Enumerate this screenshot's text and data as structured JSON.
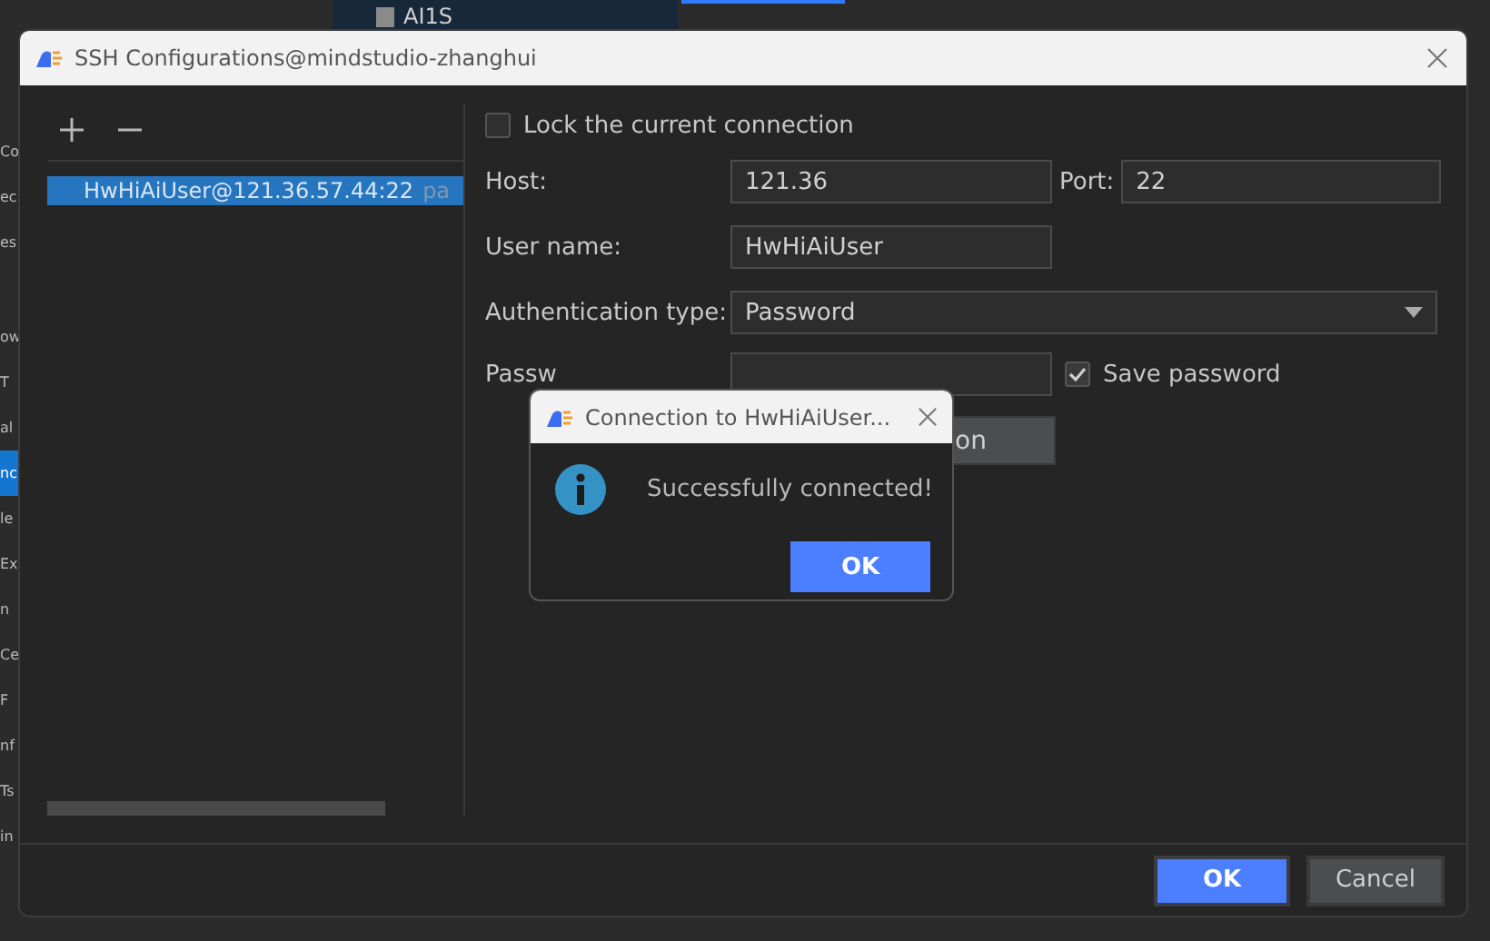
{
  "background": {
    "tab_label": "AI1S",
    "sidebar_groups": [
      [
        {
          "text": "Co",
          "selected": false
        },
        {
          "text": "ec",
          "selected": false
        },
        {
          "text": "es",
          "selected": false
        }
      ],
      [
        {
          "text": "ow",
          "selected": false
        },
        {
          "text": "T",
          "selected": false
        },
        {
          "text": "al",
          "selected": false
        },
        {
          "text": "nc",
          "selected": true
        },
        {
          "text": "le",
          "selected": false
        },
        {
          "text": "Ex",
          "selected": false
        },
        {
          "text": "n",
          "selected": false
        },
        {
          "text": "Ce",
          "selected": false
        },
        {
          "text": "F",
          "selected": false
        },
        {
          "text": "nf",
          "selected": false
        },
        {
          "text": "Ts",
          "selected": false
        },
        {
          "text": "in",
          "selected": false
        }
      ]
    ]
  },
  "dialog": {
    "title": "SSH Configurations@mindstudio-zhanghui",
    "connections": [
      {
        "name": "HwHiAiUser@121.36.57.44:22",
        "detail": "pa",
        "selected": true
      }
    ],
    "lock_connection": {
      "label": "Lock the current connection",
      "checked": false
    },
    "host": {
      "label": "Host:",
      "value": "121.36"
    },
    "port": {
      "label": "Port:",
      "value": "22"
    },
    "user_name": {
      "label": "User name:",
      "value": "HwHiAiUser"
    },
    "auth_type": {
      "label": "Authentication type:",
      "value": "Password"
    },
    "password": {
      "label": "Passw"
    },
    "save_password": {
      "label": "Save password",
      "checked": true
    },
    "test_button": "on",
    "buttons": [
      "OK",
      "Cancel"
    ]
  },
  "popup": {
    "title": "Connection to HwHiAiUser...",
    "message": "Successfully connected!",
    "button": "OK"
  }
}
